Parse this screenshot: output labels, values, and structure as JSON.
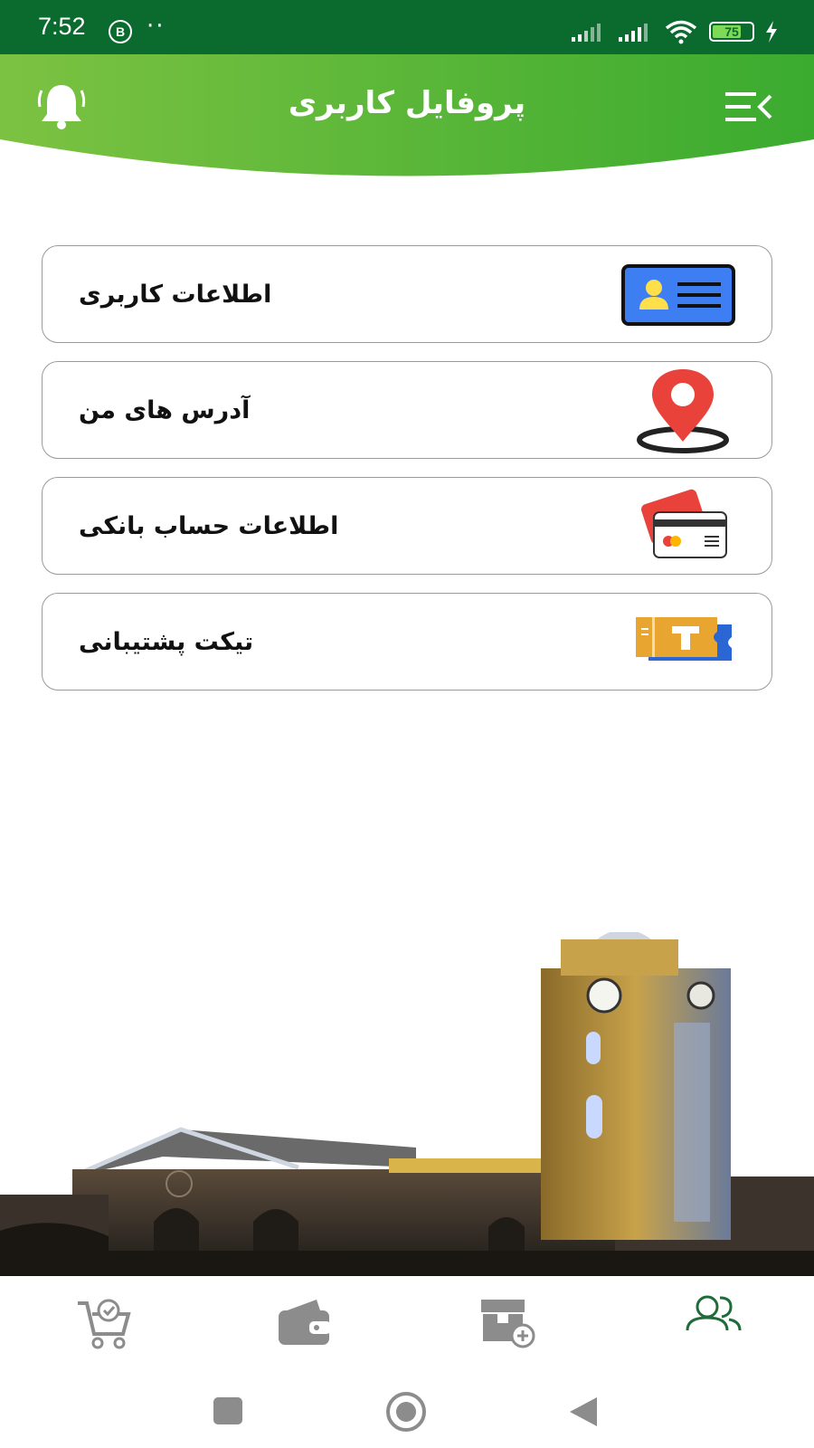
{
  "status_bar": {
    "time": "7:52",
    "badge": "B",
    "dots": "··",
    "battery": 75,
    "battery_label": "75"
  },
  "header": {
    "title": "پروفایل کاربری",
    "left_icon": "bell-icon",
    "right_icon": "menu-icon"
  },
  "menu": {
    "items": [
      {
        "label": "اطلاعات کاربری",
        "icon": "id-card-icon"
      },
      {
        "label": "آدرس های من",
        "icon": "location-pin-icon"
      },
      {
        "label": "اطلاعات حساب بانکی",
        "icon": "bank-card-icon"
      },
      {
        "label": "تیکت پشتیبانی",
        "icon": "support-ticket-icon"
      }
    ]
  },
  "bottom_nav": {
    "items": [
      {
        "icon": "cart-check-icon",
        "active": false
      },
      {
        "icon": "wallet-icon",
        "active": false
      },
      {
        "icon": "box-add-icon",
        "active": false
      },
      {
        "icon": "users-icon",
        "active": true
      }
    ]
  },
  "colors": {
    "status_bar": "#0b6b2e",
    "header_green": "#4cb830",
    "active_nav": "#1f6b3a",
    "inactive_nav": "#8c8c8c"
  }
}
